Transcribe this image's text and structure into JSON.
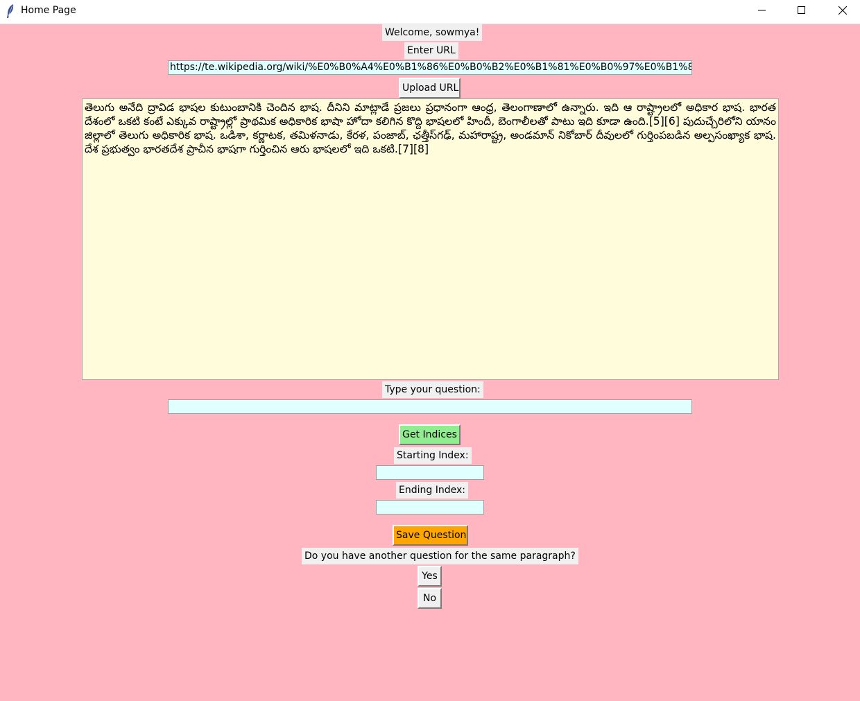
{
  "window": {
    "title": "Home Page",
    "icon": "feather-icon"
  },
  "welcome_label": "Welcome, sowmya!",
  "url_section": {
    "label": "Enter URL",
    "value": "https://te.wikipedia.org/wiki/%E0%B0%A4%E0%B1%86%E0%B0%B2%E0%B1%81%E0%B0%97%E0%B1%81",
    "upload_button": "Upload URL"
  },
  "paragraph": "తెలుగు అనేది ద్రావిడ భాషల కుటుంబానికి చెందిన భాష. దీనిని మాట్లాడే ప్రజలు ప్రధానంగా ఆంధ్ర, తెలంగాణాలో ఉన్నారు. ఇది ఆ రాష్ట్రాలలో అధికార భాష. భారతదేశంలో ఒకటి కంటే ఎక్కువ రాష్ట్రాల్లో ప్రాథమిక అధికారిక భాషా హోదా కలిగిన కొద్ది భాషలలో హిందీ, బెంగాలీలతో పాటు ఇది కూడా ఉంది.[5][6] పుదుచ్చేరిలోని యానం జిల్లాలో తెలుగు అధికారిక భాష. ఒడిశా, కర్ణాటక, తమిళనాడు, కేరళ, పంజాబ్, ఛత్తీస్‌గఢ్, మహారాష్ట్ర, అండమాన్ నికోబార్ దీవులలో గుర్తింపబడిన అల్పసంఖ్యాక భాష. దేశ ప్రభుత్వం భారతదేశ ప్రాచీన భాషగా గుర్తించిన ఆరు భాషలలో ఇది ఒకటి.[7][8]",
  "question_section": {
    "label": "Type your question:",
    "value": "",
    "get_indices_button": "Get Indices"
  },
  "indices": {
    "start_label": "Starting Index:",
    "start_value": "",
    "end_label": "Ending Index:",
    "end_value": ""
  },
  "save_button": "Save Question",
  "another_prompt": "Do you have another question for the same paragraph?",
  "yes_button": "Yes",
  "no_button": "No",
  "colors": {
    "background": "#ffb6c1",
    "entry_bg": "#e0ffff",
    "text_bg": "#fffcdc",
    "get_indices_bg": "#90ee90",
    "save_bg": "#ffa500",
    "label_bg": "#f0f0f0"
  }
}
